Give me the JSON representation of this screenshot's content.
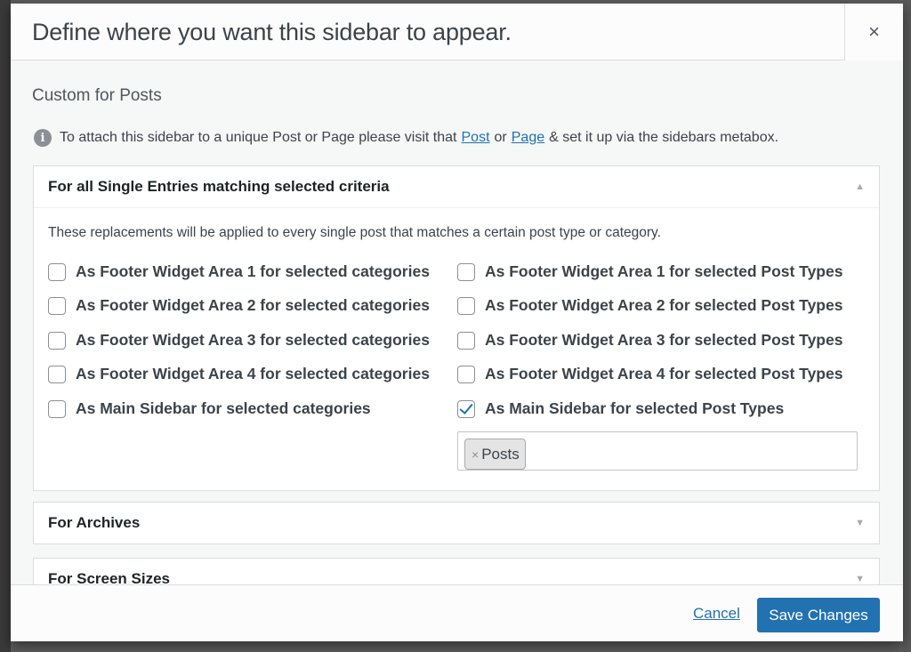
{
  "modal": {
    "title": "Define where you want this sidebar to appear.",
    "close_label": "×"
  },
  "body": {
    "subtitle": "Custom for Posts",
    "info": {
      "icon": "info-icon",
      "text_before": "To attach this sidebar to a unique Post or Page please visit that",
      "link_post": "Post",
      "text_or": "or",
      "link_page": "Page",
      "text_after": "& set it up via the sidebars metabox."
    }
  },
  "single_panel": {
    "title": "For all Single Entries matching selected criteria",
    "arrow": "▲",
    "description": "These replacements will be applied to every single post that matches a certain post type or category.",
    "left_options": [
      {
        "area": "As Footer Widget Area 1",
        "suffix": "for selected categories",
        "checked": false
      },
      {
        "area": "As Footer Widget Area 2",
        "suffix": "for selected categories",
        "checked": false
      },
      {
        "area": "As Footer Widget Area 3",
        "suffix": "for selected categories",
        "checked": false
      },
      {
        "area": "As Footer Widget Area 4",
        "suffix": "for selected categories",
        "checked": false
      },
      {
        "area": "As Main Sidebar",
        "suffix": "for selected categories",
        "checked": false
      }
    ],
    "right_options": [
      {
        "area": "As Footer Widget Area 1",
        "suffix": "for selected Post Types",
        "checked": false
      },
      {
        "area": "As Footer Widget Area 2",
        "suffix": "for selected Post Types",
        "checked": false
      },
      {
        "area": "As Footer Widget Area 3",
        "suffix": "for selected Post Types",
        "checked": false
      },
      {
        "area": "As Footer Widget Area 4",
        "suffix": "for selected Post Types",
        "checked": false
      },
      {
        "area": "As Main Sidebar",
        "suffix": "for selected Post Types",
        "checked": true
      }
    ],
    "selected_tags": [
      "Posts"
    ],
    "tag_remove": "×"
  },
  "archives_panel": {
    "title": "For Archives",
    "arrow": "▼"
  },
  "screen_panel": {
    "title": "For Screen Sizes",
    "arrow": "▼"
  },
  "footer": {
    "cancel_label": "Cancel",
    "save_label": "Save Changes"
  },
  "colors": {
    "accent": "#2271b1",
    "overlay": "#5e5e5e"
  }
}
